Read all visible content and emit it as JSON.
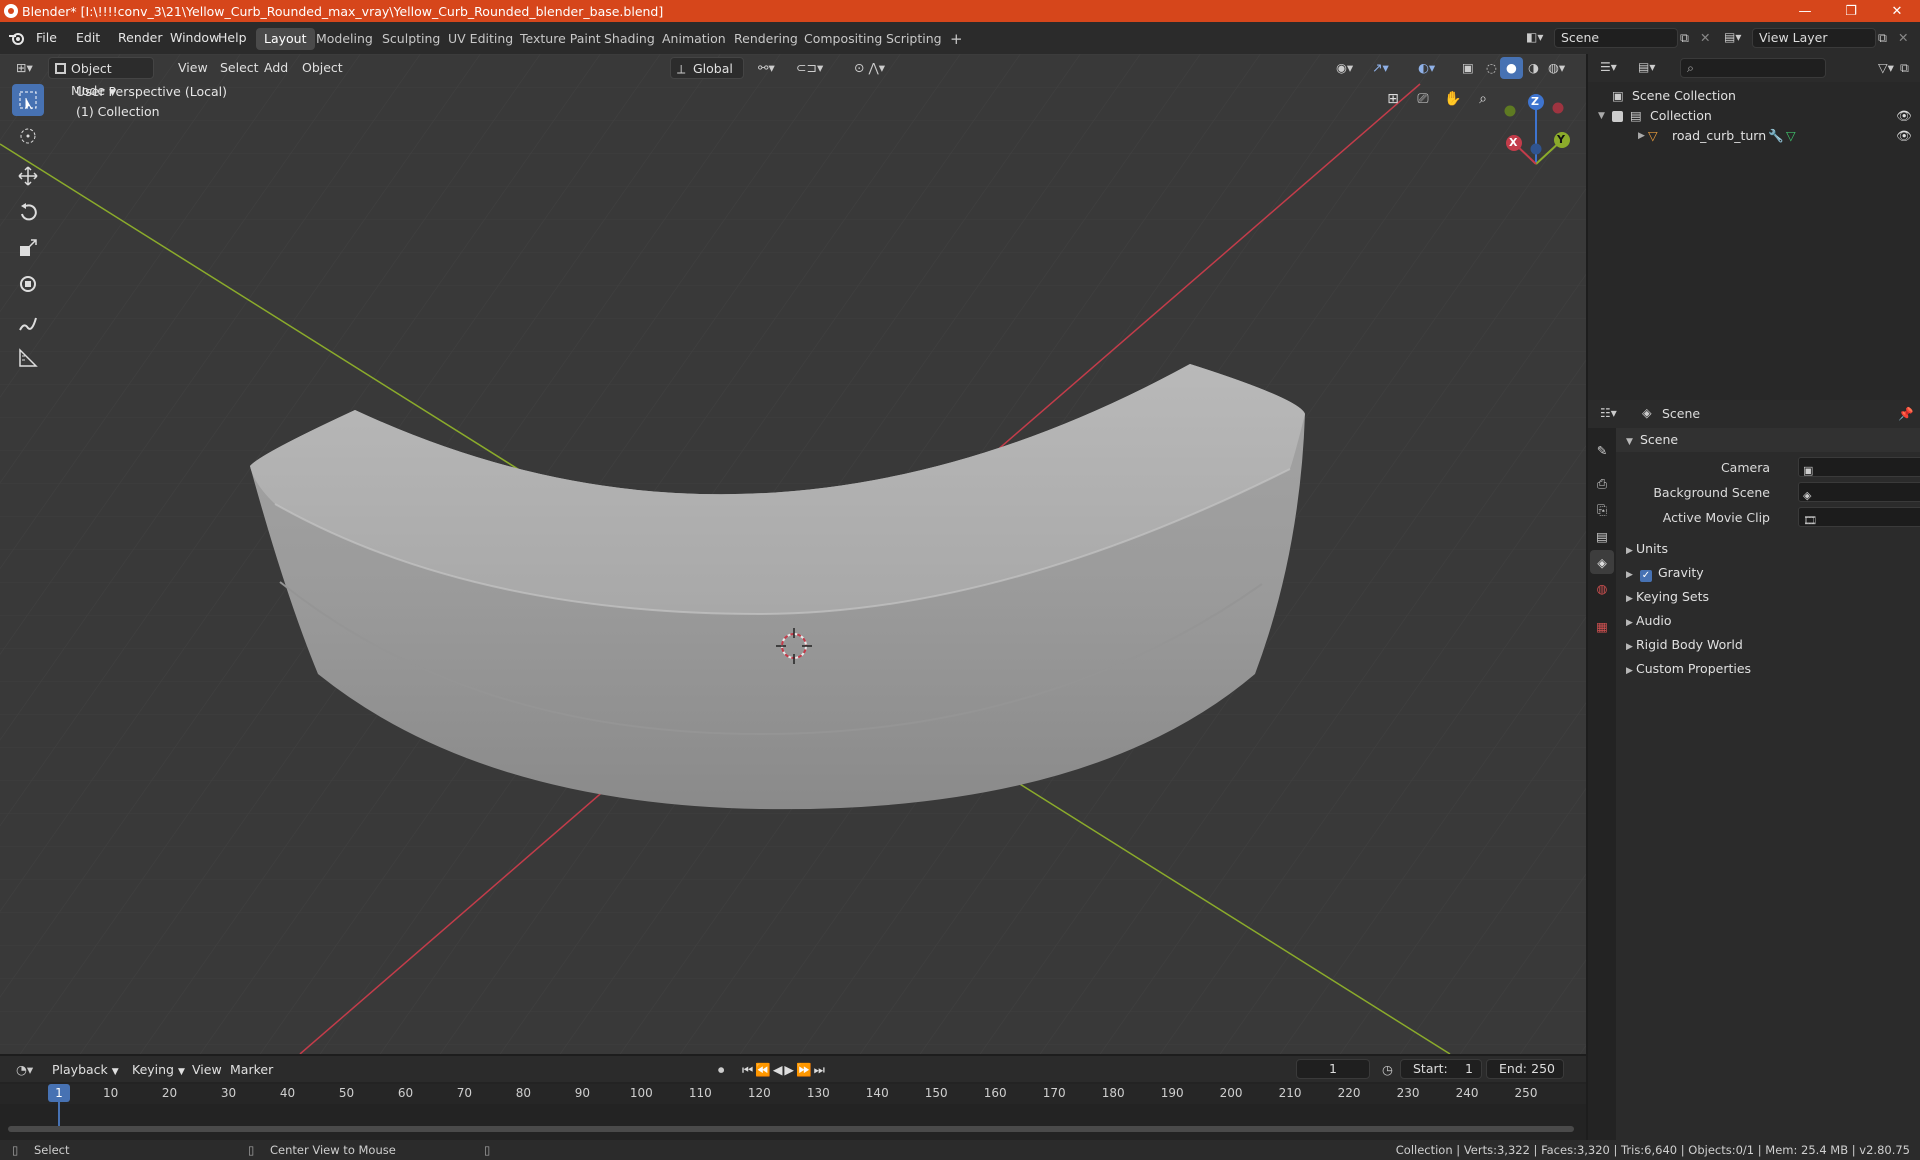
{
  "window": {
    "title": "Blender* [I:\\!!!!conv_3\\21\\Yellow_Curb_Rounded_max_vray\\Yellow_Curb_Rounded_blender_base.blend]",
    "minimize": "—",
    "maximize": "❐",
    "close": "✕"
  },
  "menu": [
    "File",
    "Edit",
    "Render",
    "Window",
    "Help"
  ],
  "workspaces": [
    "Layout",
    "Modeling",
    "Sculpting",
    "UV Editing",
    "Texture Paint",
    "Shading",
    "Animation",
    "Rendering",
    "Compositing",
    "Scripting"
  ],
  "workspace_add": "+",
  "scene_field": "Scene",
  "view_layer_field": "View Layer",
  "viewport": {
    "mode": "Object Mode",
    "menus": [
      "View",
      "Select",
      "Add",
      "Object"
    ],
    "orientation": "Global",
    "overlay_line1": "User Perspective (Local)",
    "overlay_line2": "(1) Collection",
    "gizmo": {
      "x": "X",
      "y": "Y",
      "z": "Z"
    }
  },
  "outliner": {
    "rows": [
      {
        "label": "Scene Collection"
      },
      {
        "label": "Collection"
      },
      {
        "label": "road_curb_turn"
      }
    ]
  },
  "properties": {
    "header": "Scene",
    "panel": "Scene",
    "fields": [
      {
        "label": "Camera"
      },
      {
        "label": "Background Scene"
      },
      {
        "label": "Active Movie Clip"
      }
    ],
    "sections": [
      "Units",
      "Gravity",
      "Keying Sets",
      "Audio",
      "Rigid Body World",
      "Custom Properties"
    ],
    "gravity_checked": true
  },
  "timeline": {
    "menus": [
      "Playback",
      "Keying",
      "View",
      "Marker"
    ],
    "current_frame": "1",
    "start_label": "Start:",
    "start_value": "1",
    "end_label": "End:",
    "end_value": "250",
    "ticks": [
      "1",
      "10",
      "20",
      "30",
      "40",
      "50",
      "60",
      "70",
      "80",
      "90",
      "100",
      "110",
      "120",
      "130",
      "140",
      "150",
      "160",
      "170",
      "180",
      "190",
      "200",
      "210",
      "220",
      "230",
      "240",
      "250"
    ]
  },
  "status": {
    "left": "Select",
    "middle": "Center View to Mouse",
    "right": "Collection | Verts:3,322 | Faces:3,320 | Tris:6,640 | Objects:0/1 | Mem: 25.4 MB | v2.80.75"
  },
  "colors": {
    "titlebar": "#d6461b",
    "accent": "#4772b3",
    "x_axis": "#c33c4a",
    "y_axis": "#8bab2b",
    "z_axis": "#3e74cf"
  }
}
